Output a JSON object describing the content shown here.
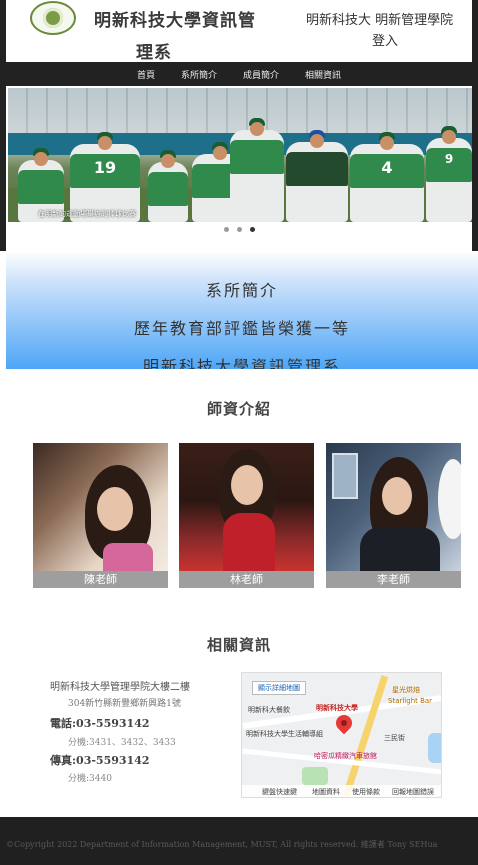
{
  "header": {
    "title_line1": "明新科技大學資訊管",
    "title_line2": "理系",
    "login_line1": "明新科技大 明新管理學院",
    "login_line2": "登入"
  },
  "nav": {
    "items": [
      "首頁",
      "系所簡介",
      "成員簡介",
      "相關資訊"
    ]
  },
  "carousel": {
    "caption": "在明新的運動場舉辦的棒球比賽",
    "jersey_numbers": [
      "19",
      "4",
      "9"
    ],
    "slide_count": 3,
    "active_slide": 3
  },
  "intro": {
    "line1": "系所簡介",
    "line2": "歷年教育部評鑑皆榮獲一等",
    "line3": "明新科技大學資訊管理系"
  },
  "faculty": {
    "title": "師資介紹",
    "members": [
      {
        "name": "陳老師"
      },
      {
        "name": "林老師"
      },
      {
        "name": "李老師"
      }
    ]
  },
  "info": {
    "title": "相關資訊",
    "address_title": "明新科技大學管理學院大樓二樓",
    "address": "304新竹縣新豐鄉新興路1號",
    "tel": "電話:03-5593142",
    "tel_ext": "分機:3431、3432、3433",
    "fax": "傳真:03-5593142",
    "fax_ext": "分機:3440"
  },
  "map": {
    "view_button": "顯示詳細地圖",
    "labels": [
      "明新科技大學",
      "明新科大餐飲",
      "星光烘焙",
      "Starlight Bar",
      "明新科技大學生活輔導組",
      "三民街",
      "哈密瓜精緻汽車旅館"
    ],
    "footer_items": [
      "鍵盤快速鍵",
      "地圖資料",
      "使用條款",
      "回報地圖錯誤"
    ]
  },
  "footer": {
    "copyright": "©Copyright 2022 Department of Information Management, MUST, All rights reserved. 維護者 Tony SEHua"
  },
  "colors": {
    "nav_bg": "#222222",
    "intro_gradient_end": "#4ea6f6",
    "jersey_green": "#2f8a4b",
    "footer_bg": "#202020"
  }
}
